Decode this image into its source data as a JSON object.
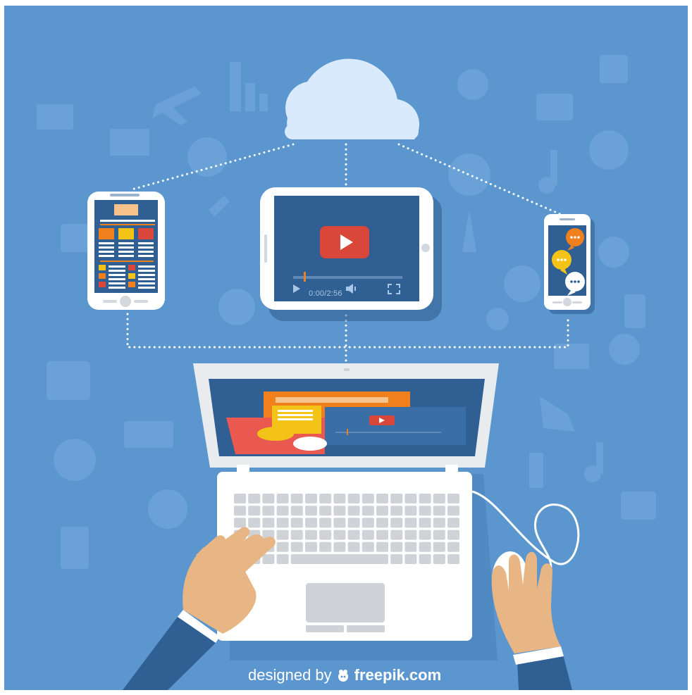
{
  "tablet_player": {
    "time": "0:00/2:56"
  },
  "watermark": {
    "by": "designed by",
    "brand": "freepik.com"
  },
  "colors": {
    "background": "#5b96cf",
    "device_body": "#ffffff",
    "screen": "#2f5f93",
    "accent_red": "#d9463a",
    "accent_orange": "#f0801d",
    "accent_yellow": "#f3c318",
    "cloud": "#d8eafb",
    "skin": "#e7b684",
    "sleeve": "#2f5f93"
  },
  "icons": [
    "cloud-icon",
    "play-icon",
    "chat-bubble-icon",
    "volume-icon",
    "fullscreen-icon",
    "mouse-icon",
    "freepik-logo-icon"
  ]
}
